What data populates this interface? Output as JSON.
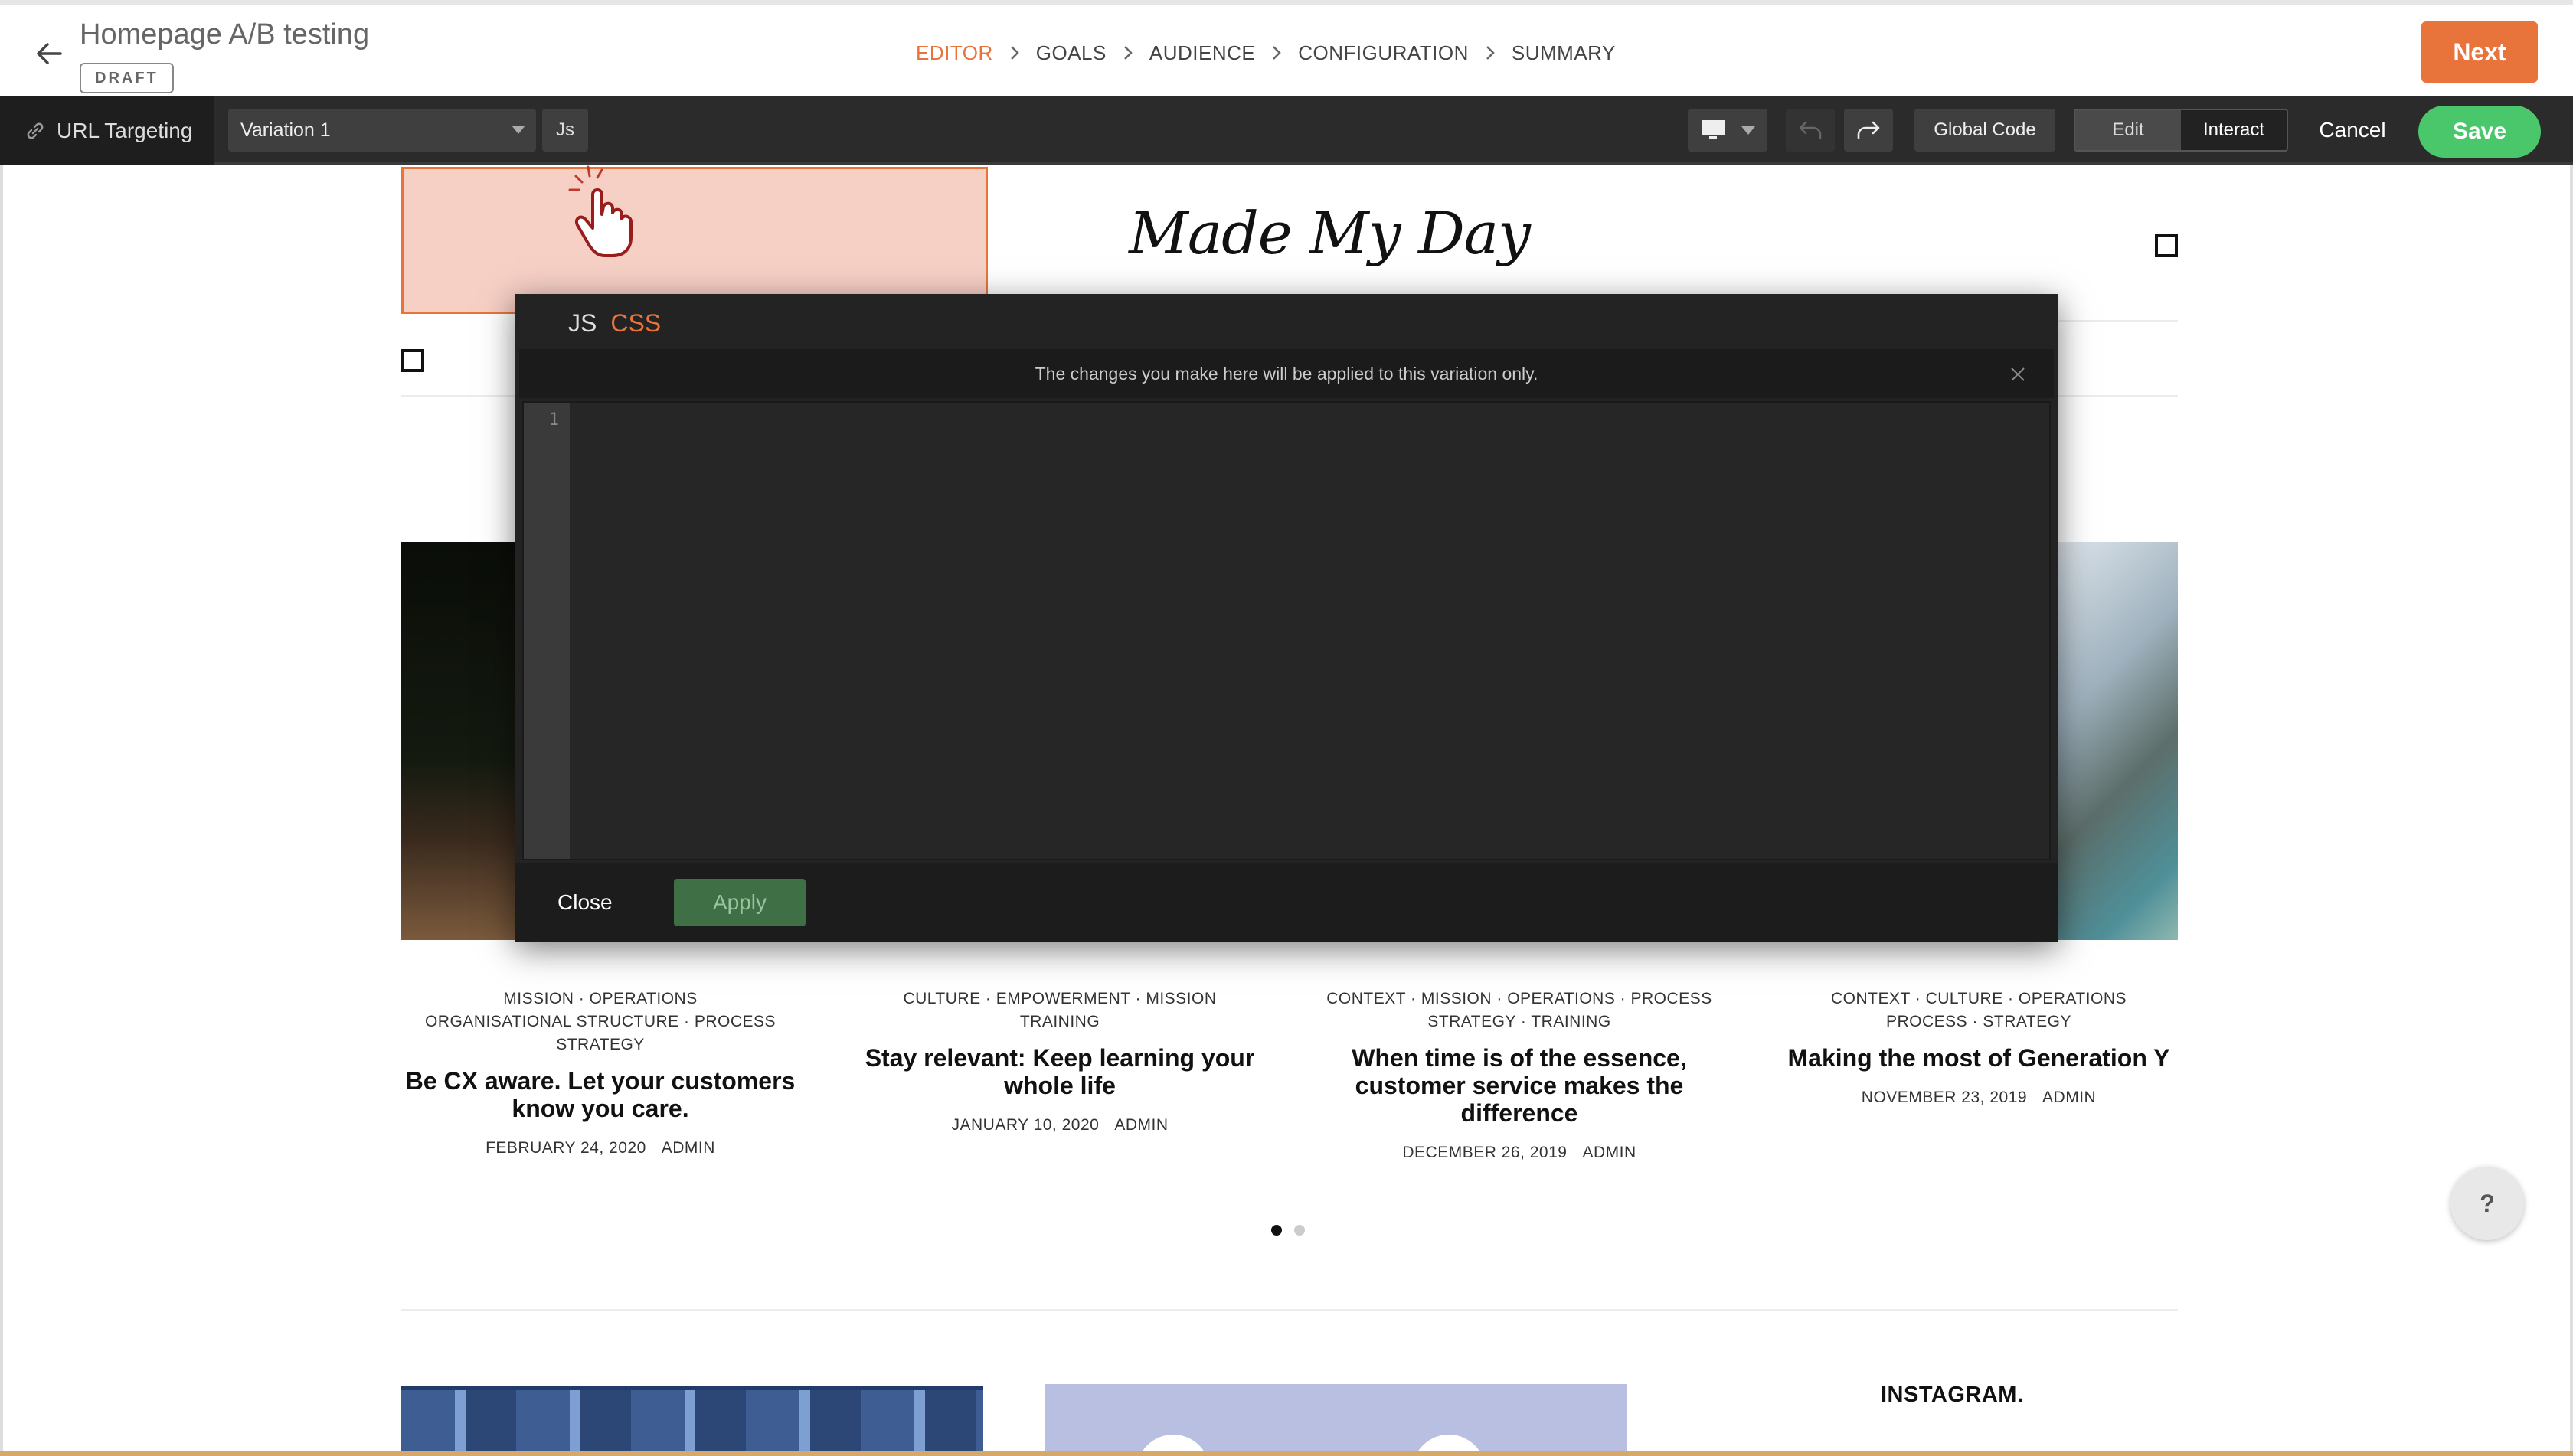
{
  "header": {
    "title": "Homepage A/B testing",
    "status_badge": "DRAFT",
    "steps": [
      {
        "label": "EDITOR",
        "active": true
      },
      {
        "label": "GOALS",
        "active": false
      },
      {
        "label": "AUDIENCE",
        "active": false
      },
      {
        "label": "CONFIGURATION",
        "active": false
      },
      {
        "label": "SUMMARY",
        "active": false
      }
    ],
    "next_label": "Next"
  },
  "toolbar": {
    "url_targeting_label": "URL Targeting",
    "variation_selected": "Variation 1",
    "js_label": "Js",
    "global_code_label": "Global Code",
    "mode_edit_label": "Edit",
    "mode_interact_label": "Interact",
    "cancel_label": "Cancel",
    "save_label": "Save"
  },
  "site": {
    "logo_text": "Made My Day",
    "posts": [
      {
        "tags_line1": "MISSION · OPERATIONS",
        "tags_line2": "ORGANISATIONAL STRUCTURE · PROCESS",
        "tags_line3": "STRATEGY",
        "title": "Be CX aware. Let your customers know you care.",
        "date": "FEBRUARY 24, 2020",
        "author": "ADMIN"
      },
      {
        "tags_line1": "CULTURE · EMPOWERMENT · MISSION",
        "tags_line2": "TRAINING",
        "tags_line3": "",
        "title": "Stay relevant: Keep learning your whole life",
        "date": "JANUARY 10, 2020",
        "author": "ADMIN"
      },
      {
        "tags_line1": "CONTEXT · MISSION · OPERATIONS · PROCESS",
        "tags_line2": "STRATEGY · TRAINING",
        "tags_line3": "",
        "title": "When time is of the essence, customer service makes the difference",
        "date": "DECEMBER 26, 2019",
        "author": "ADMIN"
      },
      {
        "tags_line1": "CONTEXT · CULTURE · OPERATIONS",
        "tags_line2": "PROCESS · STRATEGY",
        "tags_line3": "",
        "title": "Making the most of Generation Y",
        "date": "NOVEMBER 23, 2019",
        "author": "ADMIN"
      }
    ],
    "instagram_title": "INSTAGRAM."
  },
  "modal": {
    "tab_js": "JS",
    "tab_css": "CSS",
    "notice": "The changes you make here will be applied to this variation only.",
    "line_number": "1",
    "code_value": "",
    "close_label": "Close",
    "apply_label": "Apply"
  },
  "help_label": "?",
  "colors": {
    "accent": "#e8743b",
    "save_green": "#4ac66b",
    "toolbar_bg": "#2b2b2b",
    "modal_bg": "#232323"
  }
}
